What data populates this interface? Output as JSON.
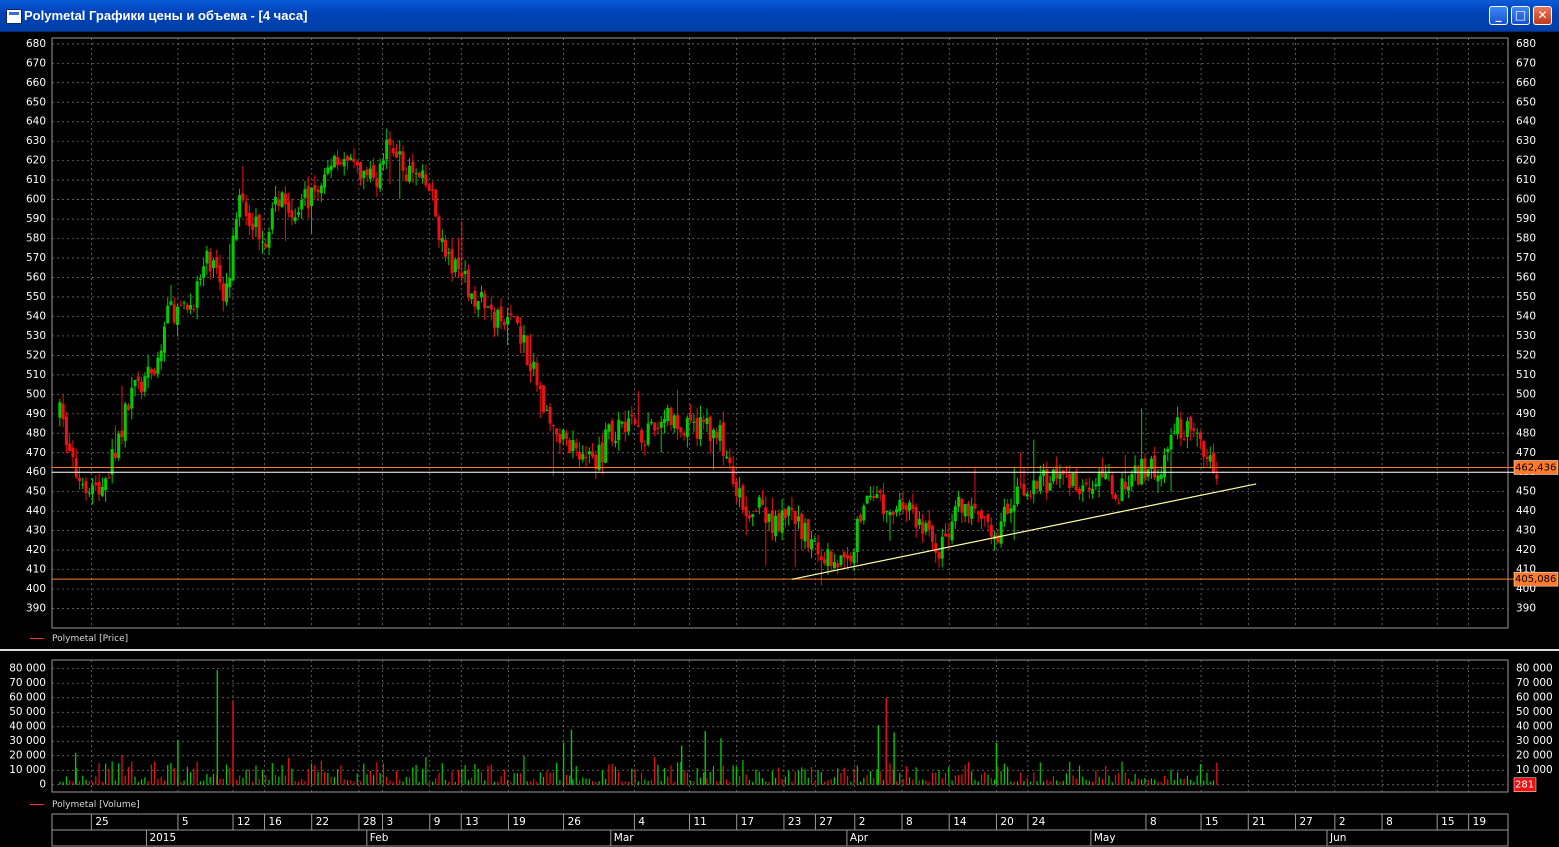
{
  "window": {
    "title": "Polymetal Графики цены и объема - [4 часа]",
    "buttons": {
      "minimize": "_",
      "maximize": "□",
      "close": "✕"
    }
  },
  "legends": {
    "price": "Polymetal [Price]",
    "volume": "Polymetal [Volume]"
  },
  "colors": {
    "up": "#00cc00",
    "down": "#ee1111",
    "background": "#000000",
    "grid": "#808080",
    "level_line": "#ff7a2a",
    "trend_line": "#ffffa0",
    "text": "#ffffff"
  },
  "chart_data": [
    {
      "type": "candlestick",
      "series": [
        {
          "name": "Polymetal [Price]"
        }
      ],
      "y_ticks": [
        390,
        400,
        410,
        420,
        430,
        440,
        450,
        460,
        470,
        480,
        490,
        500,
        510,
        520,
        530,
        540,
        550,
        560,
        570,
        580,
        590,
        600,
        610,
        620,
        630,
        640,
        650,
        660,
        670,
        680
      ],
      "ylim": [
        380,
        683
      ],
      "horizontal_levels": [
        {
          "value": 462.436,
          "label": "462,436"
        },
        {
          "value": 405.086,
          "label": "405,086"
        },
        {
          "value": 460
        }
      ],
      "trendline": {
        "from": {
          "date": "2015-04-24",
          "value": 405
        },
        "to": {
          "date": "2015-06-22",
          "value": 454
        }
      },
      "close_path": [
        [
          "2015-01-21",
          490
        ],
        [
          "2015-01-23",
          460
        ],
        [
          "2015-01-26",
          450
        ],
        [
          "2015-01-28",
          470
        ],
        [
          "2015-01-30",
          500
        ],
        [
          "2015-02-02",
          510
        ],
        [
          "2015-02-04",
          545
        ],
        [
          "2015-02-06",
          540
        ],
        [
          "2015-02-09",
          570
        ],
        [
          "2015-02-11",
          550
        ],
        [
          "2015-02-13",
          600
        ],
        [
          "2015-02-16",
          580
        ],
        [
          "2015-02-18",
          605
        ],
        [
          "2015-02-20",
          595
        ],
        [
          "2015-02-23",
          605
        ],
        [
          "2015-02-25",
          625
        ],
        [
          "2015-02-27",
          615
        ],
        [
          "2015-03-02",
          610
        ],
        [
          "2015-03-04",
          630
        ],
        [
          "2015-03-06",
          615
        ],
        [
          "2015-03-09",
          605
        ],
        [
          "2015-03-11",
          570
        ],
        [
          "2015-03-13",
          560
        ],
        [
          "2015-03-16",
          545
        ],
        [
          "2015-03-18",
          535
        ],
        [
          "2015-03-20",
          540
        ],
        [
          "2015-03-23",
          500
        ],
        [
          "2015-03-25",
          478
        ],
        [
          "2015-03-27",
          475
        ],
        [
          "2015-03-30",
          465
        ],
        [
          "2015-04-01",
          480
        ],
        [
          "2015-04-03",
          488
        ],
        [
          "2015-04-06",
          478
        ],
        [
          "2015-04-08",
          490
        ],
        [
          "2015-04-10",
          480
        ],
        [
          "2015-04-13",
          485
        ],
        [
          "2015-04-15",
          478
        ],
        [
          "2015-04-17",
          447
        ],
        [
          "2015-04-20",
          440
        ],
        [
          "2015-04-22",
          432
        ],
        [
          "2015-04-24",
          437
        ],
        [
          "2015-04-27",
          420
        ],
        [
          "2015-04-29",
          416
        ],
        [
          "2015-05-01",
          412
        ],
        [
          "2015-05-04",
          455
        ],
        [
          "2015-05-06",
          438
        ],
        [
          "2015-05-08",
          445
        ],
        [
          "2015-05-11",
          430
        ],
        [
          "2015-05-13",
          420
        ],
        [
          "2015-05-15",
          442
        ],
        [
          "2015-05-18",
          432
        ],
        [
          "2015-05-20",
          428
        ],
        [
          "2015-05-22",
          445
        ],
        [
          "2015-05-25",
          452
        ],
        [
          "2015-05-27",
          458
        ],
        [
          "2015-05-29",
          455
        ],
        [
          "2015-06-01",
          456
        ],
        [
          "2015-06-03",
          454
        ],
        [
          "2015-06-05",
          450
        ],
        [
          "2015-06-08",
          463
        ],
        [
          "2015-06-10",
          460
        ],
        [
          "2015-06-12",
          484
        ],
        [
          "2015-06-15",
          474
        ],
        [
          "2015-06-17",
          462
        ]
      ]
    },
    {
      "type": "bar",
      "series": [
        {
          "name": "Polymetal [Volume]"
        }
      ],
      "y_ticks": [
        0,
        10000,
        20000,
        30000,
        40000,
        50000,
        60000,
        70000,
        80000
      ],
      "y_tick_labels": [
        "0",
        "10 000",
        "20 000",
        "30 000",
        "40 000",
        "50 000",
        "60 000",
        "70 000",
        "80 000"
      ],
      "ylim": [
        -5000,
        86000
      ],
      "last_value_label": "281",
      "spikes": [
        {
          "date": "2015-02-10",
          "value": 79000
        },
        {
          "date": "2015-02-12",
          "value": 58000
        },
        {
          "date": "2015-02-05",
          "value": 31000
        },
        {
          "date": "2015-03-27",
          "value": 38000
        },
        {
          "date": "2015-03-26",
          "value": 29000
        },
        {
          "date": "2015-05-06",
          "value": 60000
        },
        {
          "date": "2015-05-05",
          "value": 41000
        },
        {
          "date": "2015-05-07",
          "value": 36000
        },
        {
          "date": "2015-04-13",
          "value": 37000
        },
        {
          "date": "2015-04-15",
          "value": 32000
        },
        {
          "date": "2015-05-20",
          "value": 29000
        },
        {
          "date": "2015-01-23",
          "value": 22000
        },
        {
          "date": "2015-04-10",
          "value": 27000
        }
      ]
    }
  ],
  "time_axis": {
    "day_labels": [
      {
        "date": "2015-01-25",
        "label": "25"
      },
      {
        "date": "2015-02-05",
        "label": "5"
      },
      {
        "date": "2015-02-12",
        "label": "12"
      },
      {
        "date": "2015-02-16",
        "label": "16"
      },
      {
        "date": "2015-02-22",
        "label": "22"
      },
      {
        "date": "2015-02-28",
        "label": "28"
      },
      {
        "date": "2015-03-03",
        "label": "3"
      },
      {
        "date": "2015-03-09",
        "label": "9"
      },
      {
        "date": "2015-03-13",
        "label": "13"
      },
      {
        "date": "2015-03-19",
        "label": "19"
      },
      {
        "date": "2015-03-26",
        "label": "26"
      },
      {
        "date": "2015-04-04",
        "label": "4"
      },
      {
        "date": "2015-04-11",
        "label": "11"
      },
      {
        "date": "2015-04-17",
        "label": "17"
      },
      {
        "date": "2015-04-23",
        "label": "23"
      },
      {
        "date": "2015-04-27",
        "label": "27"
      },
      {
        "date": "2015-05-02",
        "label": "2"
      },
      {
        "date": "2015-05-08",
        "label": "8"
      },
      {
        "date": "2015-05-14",
        "label": "14"
      },
      {
        "date": "2015-05-20",
        "label": "20"
      },
      {
        "date": "2015-05-24",
        "label": "24"
      },
      {
        "date": "2015-06-08",
        "label": "8"
      },
      {
        "date": "2015-06-15",
        "label": "15"
      },
      {
        "date": "2015-06-21",
        "label": "21"
      },
      {
        "date": "2015-06-27",
        "label": "27"
      },
      {
        "date": "2015-07-02",
        "label": "2"
      },
      {
        "date": "2015-07-08",
        "label": "8"
      },
      {
        "date": "2015-07-15",
        "label": "15"
      },
      {
        "date": "2015-07-19",
        "label": "19"
      }
    ],
    "period_labels": [
      {
        "date": "2015-02-01",
        "label": "2015"
      },
      {
        "date": "2015-03-01",
        "label": "Feb"
      },
      {
        "date": "2015-04-01",
        "label": "Mar"
      },
      {
        "date": "2015-05-01",
        "label": "Apr"
      },
      {
        "date": "2015-06-01",
        "label": "May"
      },
      {
        "date": "2015-07-01",
        "label": "Jun"
      }
    ]
  }
}
